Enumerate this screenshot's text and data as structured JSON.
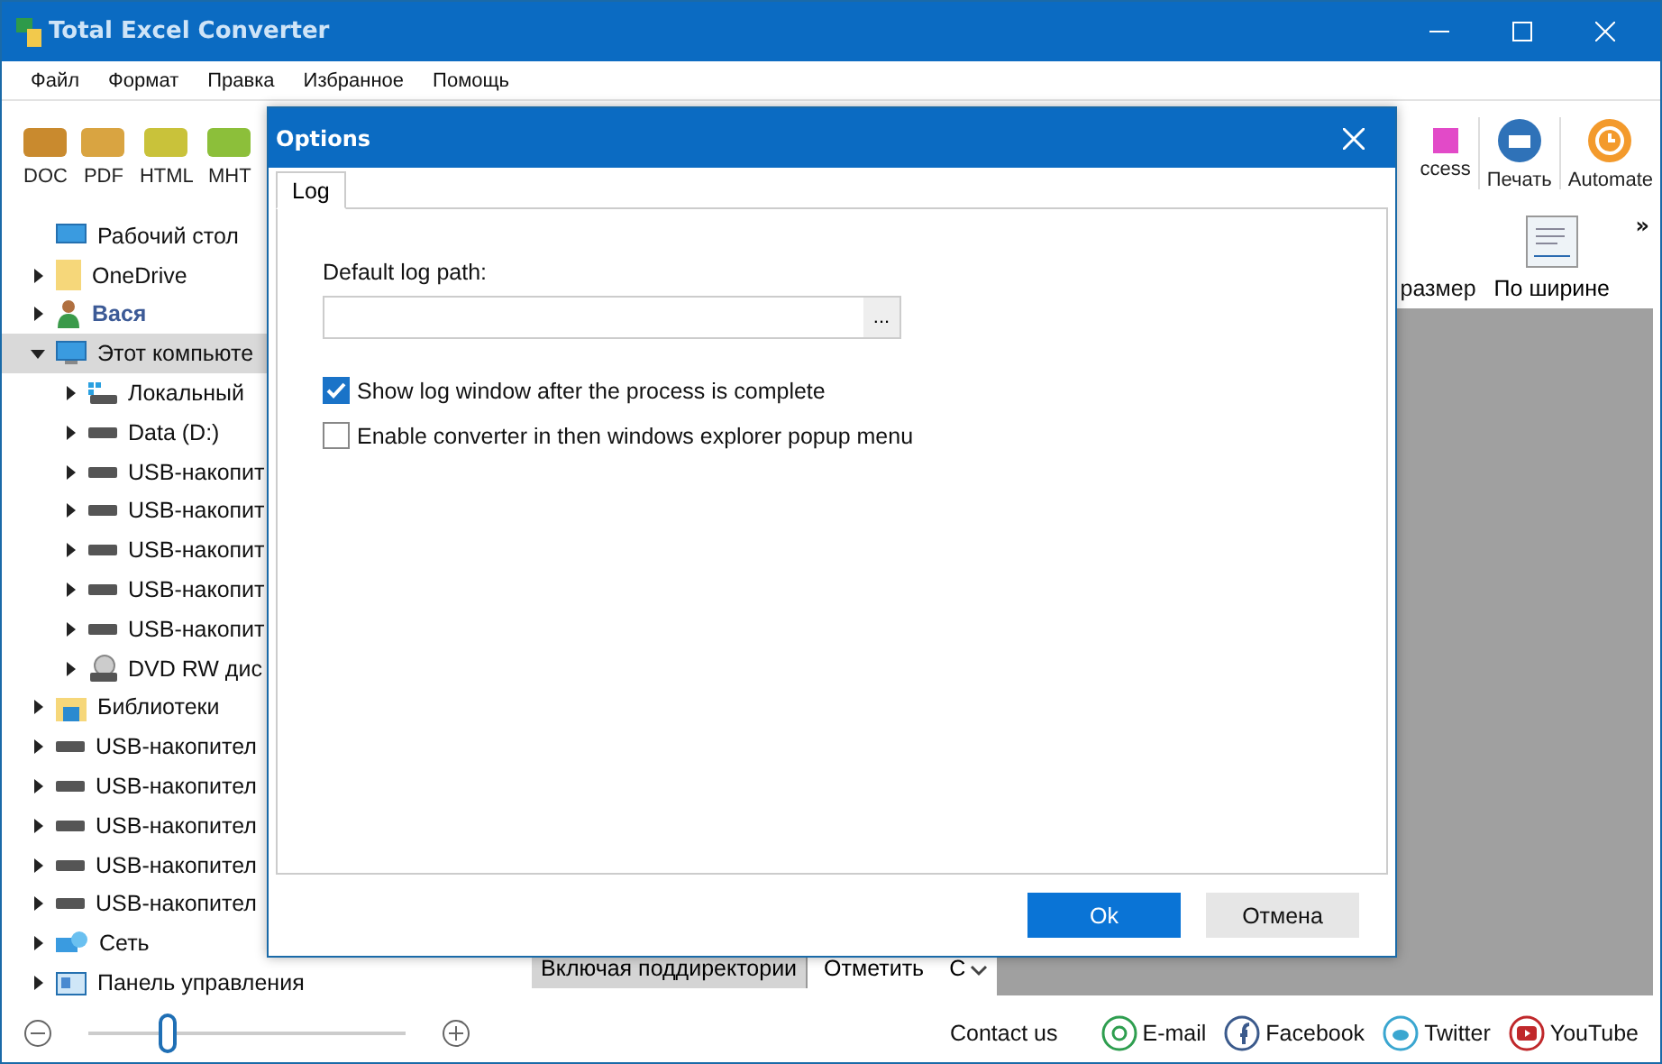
{
  "window": {
    "title": "Total Excel Converter"
  },
  "menu": [
    "Файл",
    "Формат",
    "Правка",
    "Избранное",
    "Помощь"
  ],
  "toolbar": {
    "formats": [
      {
        "label": "DOC",
        "color": "#c98a2e"
      },
      {
        "label": "PDF",
        "color": "#d9a441"
      },
      {
        "label": "HTML",
        "color": "#c9c23a"
      },
      {
        "label": "MHT",
        "color": "#8cbf3a"
      }
    ],
    "right": [
      {
        "label": "ccess",
        "kind": "access"
      },
      {
        "label": "Печать",
        "kind": "print"
      },
      {
        "label": "Automate",
        "kind": "automate"
      }
    ]
  },
  "tree": [
    {
      "label": "Рабочий стол",
      "kind": "desktop",
      "has_children": false,
      "selected": false
    },
    {
      "label": "OneDrive",
      "kind": "folder",
      "has_children": true,
      "expanded": false,
      "selected": false
    },
    {
      "label": "Вася",
      "kind": "user",
      "has_children": true,
      "expanded": false,
      "selected": false
    },
    {
      "label": "Этот компьюте",
      "kind": "computer",
      "has_children": true,
      "expanded": true,
      "selected": true,
      "children": [
        {
          "label": "Локальный",
          "kind": "windrive",
          "has_children": true,
          "expanded": false,
          "selected": false
        },
        {
          "label": "Data (D:)",
          "kind": "drive",
          "has_children": true,
          "expanded": false,
          "selected": false
        },
        {
          "label": "USB-накопит",
          "kind": "drive",
          "has_children": true,
          "expanded": false,
          "selected": false
        },
        {
          "label": "USB-накопит",
          "kind": "drive",
          "has_children": true,
          "expanded": false,
          "selected": false
        },
        {
          "label": "USB-накопит",
          "kind": "drive",
          "has_children": true,
          "expanded": false,
          "selected": false
        },
        {
          "label": "USB-накопит",
          "kind": "drive",
          "has_children": true,
          "expanded": false,
          "selected": false
        },
        {
          "label": "USB-накопит",
          "kind": "drive",
          "has_children": true,
          "expanded": false,
          "selected": false
        },
        {
          "label": "DVD RW дис",
          "kind": "dvd",
          "has_children": true,
          "expanded": false,
          "selected": false
        }
      ]
    },
    {
      "label": "Библиотеки",
      "kind": "library",
      "has_children": true,
      "expanded": false,
      "selected": false
    },
    {
      "label": "USB-накопител",
      "kind": "drive",
      "has_children": true,
      "expanded": false,
      "selected": false
    },
    {
      "label": "USB-накопител",
      "kind": "drive",
      "has_children": true,
      "expanded": false,
      "selected": false
    },
    {
      "label": "USB-накопител",
      "kind": "drive",
      "has_children": true,
      "expanded": false,
      "selected": false
    },
    {
      "label": "USB-накопител",
      "kind": "drive",
      "has_children": true,
      "expanded": false,
      "selected": false
    },
    {
      "label": "USB-накопител",
      "kind": "drive",
      "has_children": true,
      "expanded": false,
      "selected": false
    },
    {
      "label": "Сеть",
      "kind": "network",
      "has_children": true,
      "expanded": false,
      "selected": false
    },
    {
      "label": "Панель управления",
      "kind": "panel",
      "has_children": true,
      "expanded": false,
      "selected": false
    }
  ],
  "filter_bar": [
    {
      "label": "Включая поддиректории",
      "selected": true
    },
    {
      "label": "Отметить",
      "selected": false
    },
    {
      "label": "С",
      "selected": false
    }
  ],
  "preview_toolbar": {
    "items": [
      "размер",
      "По ширине"
    ],
    "more": "»"
  },
  "zoom": {
    "level": 0.25
  },
  "contacts": {
    "label": "Contact us",
    "links": [
      {
        "label": "E-mail",
        "kind": "email",
        "color": "#2e9e4f"
      },
      {
        "label": "Facebook",
        "kind": "facebook",
        "color": "#3b5a8c"
      },
      {
        "label": "Twitter",
        "kind": "twitter",
        "color": "#3aa6d0"
      },
      {
        "label": "YouTube",
        "kind": "youtube",
        "color": "#c0282b"
      }
    ]
  },
  "dialog": {
    "title": "Options",
    "tabs": [
      {
        "label": "Log",
        "selected": true
      }
    ],
    "path_label": "Default log path:",
    "browse": "...",
    "options": [
      {
        "label": "Show log window after the process is complete",
        "checked": true
      },
      {
        "label": "Enable converter in then windows explorer popup menu",
        "checked": false
      }
    ],
    "buttons": [
      {
        "label": "Ok",
        "kind": "primary"
      },
      {
        "label": "Отмена",
        "kind": "secondary"
      }
    ]
  }
}
